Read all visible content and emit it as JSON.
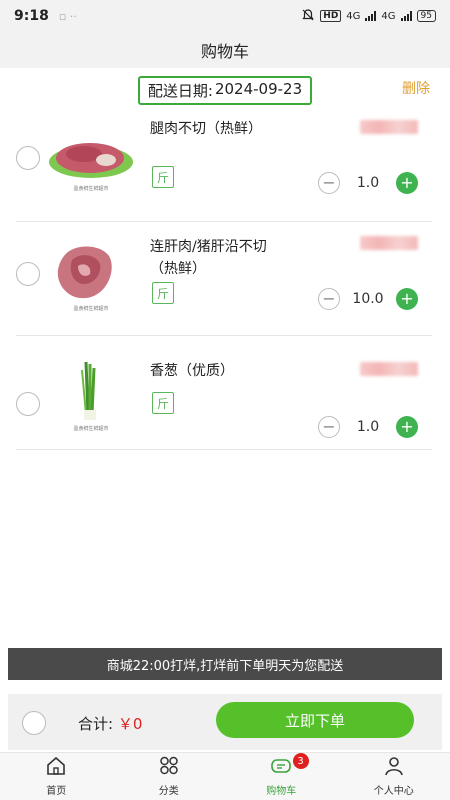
{
  "status_bar": {
    "time": "9:18",
    "network_left": "4G",
    "network_right": "4G",
    "hd": "HD",
    "battery": "95"
  },
  "header": {
    "title": "购物车"
  },
  "delivery": {
    "label": "配送日期:",
    "date": "2024-09-23"
  },
  "actions": {
    "delete_label": "删除"
  },
  "cart": {
    "items": [
      {
        "title": "腿肉不切（热鲜）",
        "unit": "斤",
        "quantity": "1.0",
        "checked": false,
        "image": "pork-leg-meat"
      },
      {
        "title": "连肝肉/猪肝沿不切（热鲜）",
        "unit": "斤",
        "quantity": "10.0",
        "checked": false,
        "image": "pork-liver-meat"
      },
      {
        "title": "香葱（优质）",
        "unit": "斤",
        "quantity": "1.0",
        "checked": false,
        "image": "green-onion"
      }
    ]
  },
  "notice": {
    "text": "商城22:00打烊,打烊前下单明天为您配送"
  },
  "footer": {
    "total_label": "合计:",
    "total_value": "￥0",
    "order_button": "立即下单"
  },
  "tabbar": {
    "items": [
      {
        "label": "首页",
        "icon": "home-icon"
      },
      {
        "label": "分类",
        "icon": "category-icon"
      },
      {
        "label": "购物车",
        "icon": "cart-icon",
        "badge": "3",
        "active": true
      },
      {
        "label": "个人中心",
        "icon": "user-icon"
      }
    ]
  },
  "colors": {
    "accent_green": "#3fb34f",
    "button_green": "#55c02a",
    "delete_orange": "#e0a030",
    "total_red": "#e02020"
  }
}
